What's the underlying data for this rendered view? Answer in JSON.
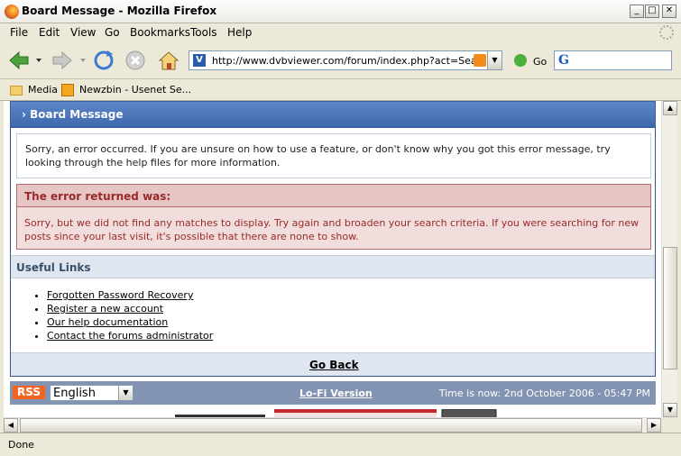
{
  "window": {
    "title": "Board Message - Mozilla Firefox"
  },
  "menu": {
    "items": [
      "File",
      "Edit",
      "View",
      "Go",
      "Bookmarks",
      "Tools",
      "Help"
    ]
  },
  "navbar": {
    "url": "http://www.dvbviewer.com/forum/index.php?act=Search&",
    "go_label": "Go",
    "search_logo": "G"
  },
  "bookmarks": {
    "items": [
      "Media",
      "Newzbin - Usenet Se..."
    ]
  },
  "page": {
    "maintitle": "Board Message",
    "intro": "Sorry, an error occurred. If you are unsure on how to use a feature, or don't know why you got this error message, try looking through the help files for more information.",
    "error_heading": "The error returned was:",
    "error_body": "Sorry, but we did not find any matches to display. Try again and broaden your search criteria. If you were searching for new posts since your last visit, it's possible that there are none to show.",
    "useful_links_heading": "Useful Links",
    "useful_links": [
      "Forgotten Password Recovery",
      "Register a new account",
      "Our help documentation",
      "Contact the forums administrator"
    ],
    "go_back": "Go Back",
    "footer": {
      "rss": "RSS",
      "language": "English",
      "lofi": "Lo-Fi Version",
      "time": "Time is now: 2nd October 2006 - 05:47 PM"
    }
  },
  "status": {
    "text": "Done"
  },
  "colors": {
    "maintitle_bg": "#4a74b8",
    "error_bg": "#f2dddd",
    "error_text": "#992a2a",
    "footer_bg": "#8394b2"
  }
}
